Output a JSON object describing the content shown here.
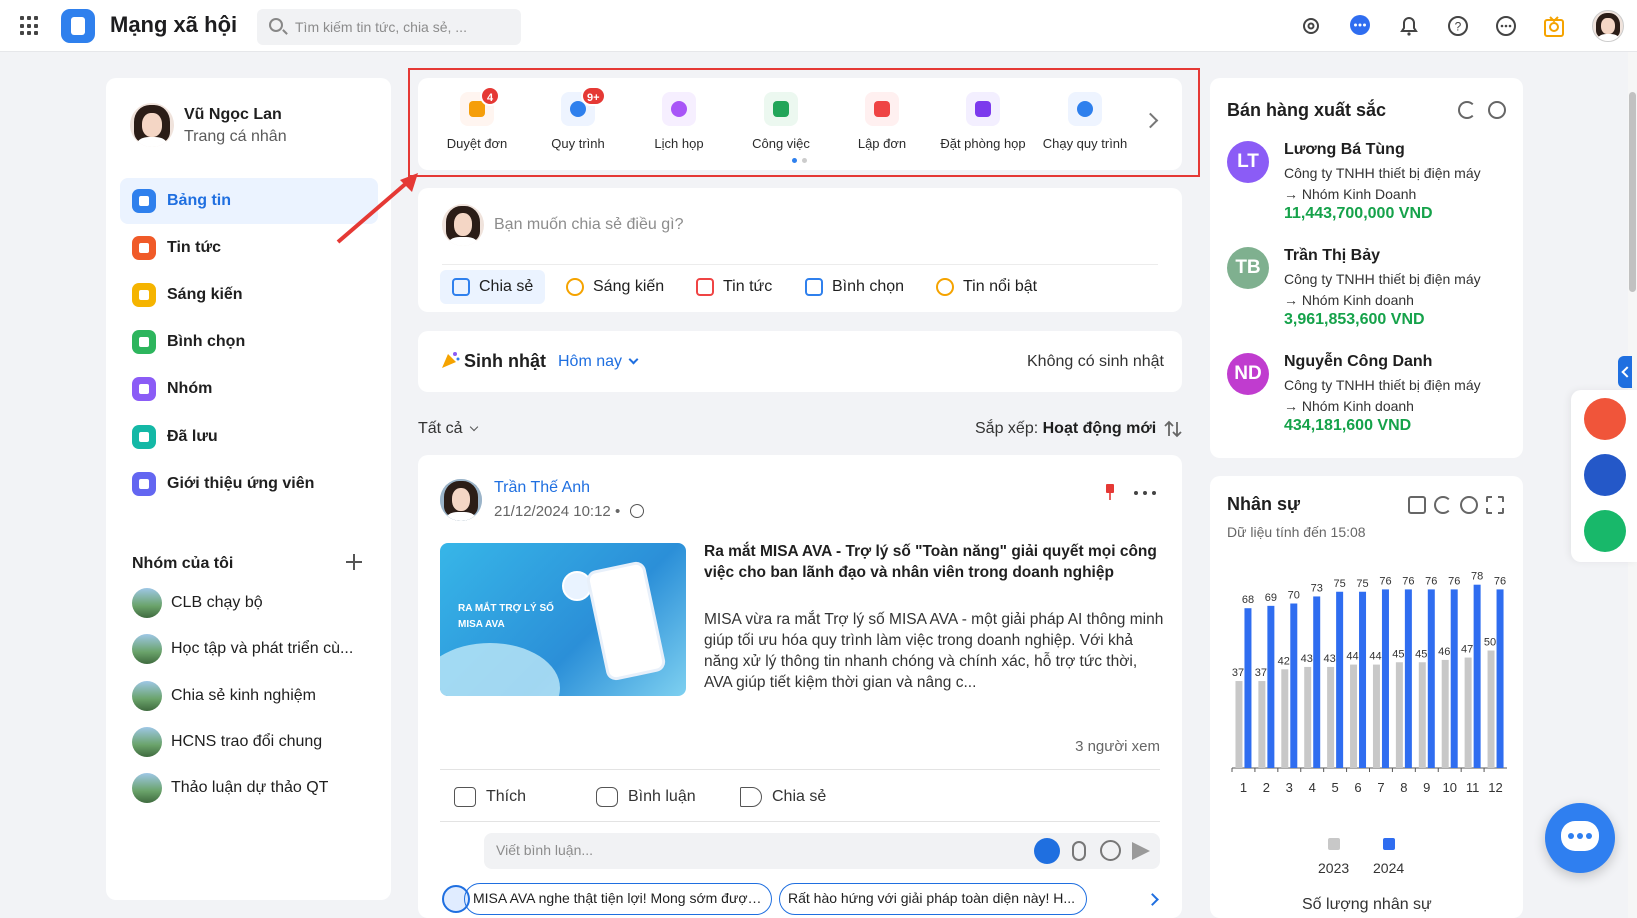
{
  "topbar": {
    "app_title": "Mạng xã hội",
    "search_placeholder": "Tìm kiếm tin tức, chia sẻ, ..."
  },
  "sidebar": {
    "profile": {
      "name": "Vũ Ngọc Lan",
      "subtitle": "Trang cá nhân"
    },
    "items": [
      {
        "label": "Bảng tin",
        "color": "#2f80ed",
        "active": true
      },
      {
        "label": "Tin tức",
        "color": "#f05a28"
      },
      {
        "label": "Sáng kiến",
        "color": "#f5b400"
      },
      {
        "label": "Bình chọn",
        "color": "#2db55d"
      },
      {
        "label": "Nhóm",
        "color": "#8b5cf6"
      },
      {
        "label": "Đã lưu",
        "color": "#14b8a6"
      },
      {
        "label": "Giới thiệu ứng viên",
        "color": "#6366f1"
      }
    ],
    "groups_title": "Nhóm của tôi",
    "groups": [
      {
        "label": "CLB chạy bộ"
      },
      {
        "label": "Học tập và phát triển cù..."
      },
      {
        "label": "Chia sẻ kinh nghiệm"
      },
      {
        "label": "HCNS trao đổi chung"
      },
      {
        "label": "Thảo luận dự thảo QT"
      }
    ]
  },
  "shortcuts": [
    {
      "label": "Duyệt đơn",
      "badge": "4",
      "color": "#f59e0b"
    },
    {
      "label": "Quy trình",
      "badge": "9+",
      "color": "#2f80ed"
    },
    {
      "label": "Lịch họp",
      "badge": "",
      "color": "#a855f7"
    },
    {
      "label": "Công việc",
      "badge": "",
      "color": "#22a559"
    },
    {
      "label": "Lập đơn",
      "badge": "",
      "color": "#ef4444"
    },
    {
      "label": "Đặt phòng họp",
      "badge": "",
      "color": "#7c3aed"
    },
    {
      "label": "Chạy quy trình",
      "badge": "",
      "color": "#2f80ed"
    }
  ],
  "composer": {
    "placeholder": "Bạn muốn chia sẻ điều gì?",
    "tabs": [
      {
        "label": "Chia sẻ",
        "color": "#2f80ed"
      },
      {
        "label": "Sáng kiến",
        "color": "#f5a300"
      },
      {
        "label": "Tin tức",
        "color": "#ef4444"
      },
      {
        "label": "Bình chọn",
        "color": "#2f80ed"
      },
      {
        "label": "Tin nổi bật",
        "color": "#f5a300"
      }
    ]
  },
  "birthday": {
    "title": "Sinh nhật",
    "selector": "Hôm nay",
    "empty_text": "Không có sinh nhật"
  },
  "feed_filter": {
    "all_label": "Tất cả",
    "sort_prefix": "Sắp xếp:",
    "sort_value": "Hoạt động mới"
  },
  "post": {
    "author": "Trần Thế Anh",
    "time": "21/12/2024 10:12",
    "time_sep": "•",
    "image_text": "RA MẮT TRỢ LÝ SỐ MISA AVA",
    "title": "Ra mắt MISA AVA - Trợ lý số \"Toàn năng\" giải quyết mọi công việc cho ban lãnh đạo và nhân viên trong doanh nghiệp",
    "body": "MISA vừa ra mắt Trợ lý số MISA AVA - một giải pháp AI thông minh giúp tối ưu hóa quy trình làm việc trong doanh nghiệp. Với khả năng xử lý thông tin nhanh chóng và chính xác, hỗ trợ tức thời, AVA giúp tiết kiệm thời gian và nâng c...",
    "views": "3 người xem",
    "actions": {
      "like": "Thích",
      "comment": "Bình luận",
      "share": "Chia sẻ"
    },
    "comment_placeholder": "Viết bình luận...",
    "suggestions": [
      "MISA AVA nghe thật tiện lợi! Mong sớm được...",
      "Rất hào hứng với giải pháp toàn diện này! H..."
    ]
  },
  "top_sellers": {
    "title": "Bán hàng xuất sắc",
    "items": [
      {
        "initials": "LT",
        "name": "Lương Bá Tùng",
        "company": "Công ty TNHH thiết bị điện máy",
        "group": "→ Nhóm Kinh Doanh",
        "amount": "11,443,700,000 VND",
        "color": "#8b5cf6"
      },
      {
        "initials": "TB",
        "name": "Trần Thị Bảy",
        "company": "Công ty TNHH thiết bị điện máy",
        "group": "→ Nhóm Kinh doanh",
        "amount": "3,961,853,600 VND",
        "color": "#7fb08f"
      },
      {
        "initials": "ND",
        "name": "Nguyễn Công Danh",
        "company": "Công ty TNHH thiết bị điện máy",
        "group": "→ Nhóm Kinh doanh",
        "amount": "434,181,600 VND",
        "color": "#c03ccf"
      }
    ]
  },
  "hr_panel": {
    "title": "Nhân sự",
    "subtitle": "Dữ liệu tính đến 15:08",
    "caption": "Số lượng nhân sự"
  },
  "chart_data": {
    "type": "bar",
    "categories": [
      "1",
      "2",
      "3",
      "4",
      "5",
      "6",
      "7",
      "8",
      "9",
      "10",
      "11",
      "12"
    ],
    "series": [
      {
        "name": "2023",
        "values": [
          37,
          37,
          42,
          43,
          43,
          44,
          44,
          45,
          45,
          46,
          47,
          50
        ],
        "color": "#c8c8c8"
      },
      {
        "name": "2024",
        "values": [
          68,
          69,
          70,
          73,
          75,
          75,
          76,
          76,
          76,
          76,
          78,
          76
        ],
        "color": "#2f6df0"
      }
    ],
    "xlabel": "",
    "ylabel": "",
    "ylim": [
      0,
      80
    ],
    "legend_position": "bottom",
    "grid": false
  }
}
